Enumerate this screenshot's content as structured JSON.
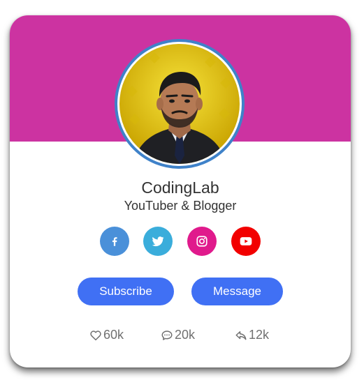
{
  "colors": {
    "banner": "#cc33a1",
    "ring": "#3f82c9",
    "button": "#4070f4",
    "facebook": "#4a90d9",
    "twitter": "#3aaddb",
    "instagram": "#e01a8c",
    "youtube": "#f20000"
  },
  "profile": {
    "name": "CodingLab",
    "role": "YouTuber & Blogger",
    "avatar_icon": "profile-photo"
  },
  "socials": [
    {
      "icon": "facebook-icon"
    },
    {
      "icon": "twitter-icon"
    },
    {
      "icon": "instagram-icon"
    },
    {
      "icon": "youtube-icon"
    }
  ],
  "buttons": {
    "subscribe_label": "Subscribe",
    "message_label": "Message"
  },
  "stats": {
    "likes": {
      "icon": "heart-icon",
      "count": "60k"
    },
    "comments": {
      "icon": "comment-icon",
      "count": "20k"
    },
    "shares": {
      "icon": "share-icon",
      "count": "12k"
    }
  }
}
